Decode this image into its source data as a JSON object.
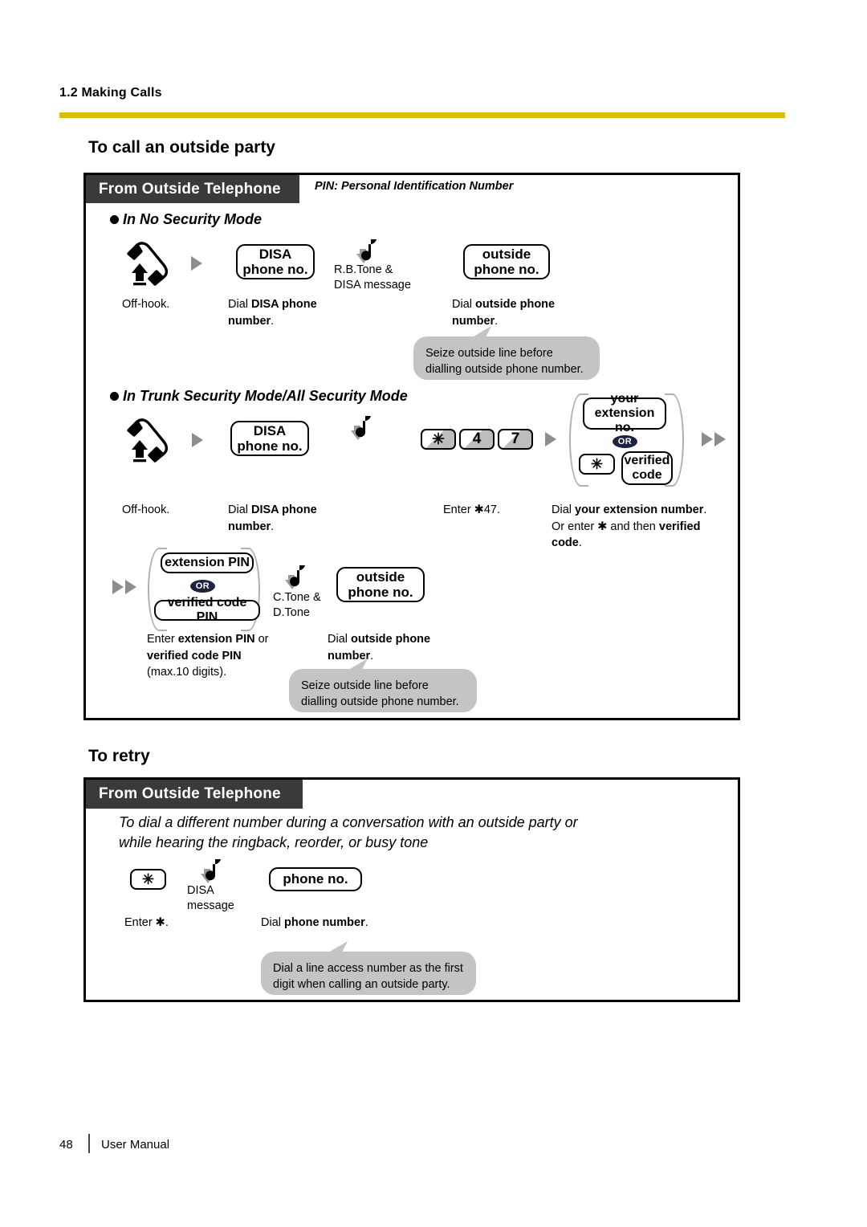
{
  "page": {
    "running_head": "1.2 Making Calls",
    "footer_page_number": "48",
    "footer_label": "User Manual",
    "rule_color": "#d9bd10"
  },
  "section1": {
    "title": "To call an outside party",
    "tab_label": "From Outside Telephone",
    "pin_note": "PIN: Personal Identification Number",
    "mode_a": {
      "heading": "In No Security Mode",
      "steps": [
        {
          "icon": "offhook-handset-icon",
          "caption": "Off-hook."
        },
        {
          "key_line1": "DISA",
          "key_line2": "phone no.",
          "caption_plain": "Dial ",
          "caption_bold": "DISA phone number",
          "caption_end": "."
        },
        {
          "tone_line1": "R.B.Tone &",
          "tone_line2": "DISA message"
        },
        {
          "key_line1": "outside",
          "key_line2": "phone no.",
          "caption_plain": "Dial ",
          "caption_bold": "outside phone number",
          "caption_end": "."
        }
      ],
      "bubble": "Seize outside line before dialling outside phone number."
    },
    "mode_b": {
      "heading": "In Trunk Security Mode/All Security Mode",
      "row1": {
        "offhook_caption": "Off-hook.",
        "disa_key_line1": "DISA",
        "disa_key_line2": "phone no.",
        "disa_caption_plain": "Dial ",
        "disa_caption_bold": "DISA phone number",
        "disa_caption_end": ".",
        "dial_keys": [
          "✳",
          "4",
          "7"
        ],
        "dial_caption": "Enter ✱47.",
        "ext_key_line1": "your",
        "ext_key_line2": "extension no.",
        "or_label": "OR",
        "star_key": "✳",
        "verified_line1": "verified",
        "verified_line2": "code",
        "ext_caption_l1_plain": "Dial ",
        "ext_caption_l1_bold": "your extension number",
        "ext_caption_l1_end": ".",
        "ext_caption_l2_plain": "Or enter ✱ and then ",
        "ext_caption_l2_bold": "verified code",
        "ext_caption_l2_end": "."
      },
      "row2": {
        "pin_key": "extension PIN",
        "or_label": "OR",
        "verified_pin_key": "verified code PIN",
        "tone_line1": "C.Tone &",
        "tone_line2": "D.Tone",
        "outside_key_line1": "outside",
        "outside_key_line2": "phone no.",
        "pin_caption_l1_plain": "Enter ",
        "pin_caption_l1_bold": "extension PIN",
        "pin_caption_l1_end": " or",
        "pin_caption_l2_bold": "verified code PIN",
        "pin_caption_l3": "(max.10 digits).",
        "outside_caption_plain": "Dial ",
        "outside_caption_bold": "outside phone number",
        "outside_caption_end": ".",
        "bubble": "Seize outside line before dialling outside phone number."
      }
    }
  },
  "section2": {
    "title": "To retry",
    "tab_label": "From Outside Telephone",
    "description_line1": "To dial a different number during a conversation with an outside party or",
    "description_line2": "while hearing the ringback, reorder, or busy tone",
    "star_key": "✳",
    "star_caption": "Enter ✱.",
    "tone_line1": "DISA",
    "tone_line2": "message",
    "phone_key": "phone no.",
    "phone_caption_plain": "Dial ",
    "phone_caption_bold": "phone number",
    "phone_caption_end": ".",
    "bubble": "Dial a line access number as the first digit when calling an outside party."
  }
}
